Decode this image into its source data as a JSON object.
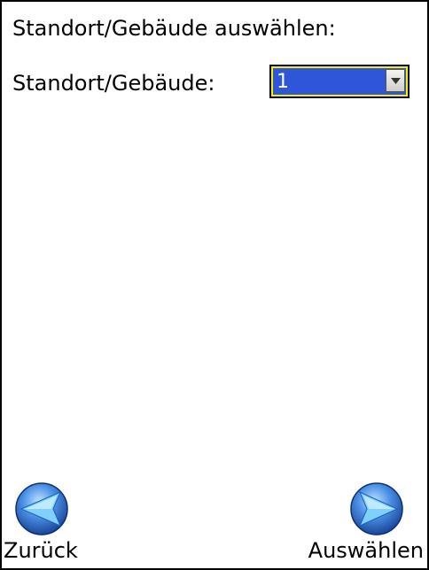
{
  "screen": {
    "heading": "Standort/Gebäude auswählen:"
  },
  "form": {
    "field_label": "Standort/Gebäude:",
    "selected_value": "1"
  },
  "footer": {
    "back_label": "Zurück",
    "select_label": "Auswählen",
    "back_icon": "left-arrow-orb-icon",
    "select_icon": "right-arrow-orb-icon"
  },
  "colors": {
    "combo_fill": "#2f55d8",
    "combo_border": "#f5f000",
    "orb_blue": "#2a6ad6"
  }
}
